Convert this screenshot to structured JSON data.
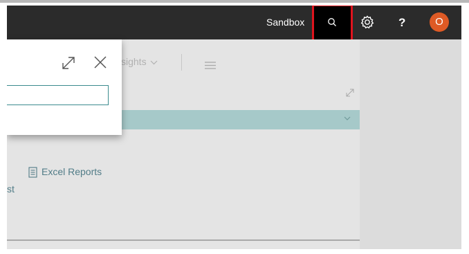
{
  "topbar": {
    "environment_label": "Sandbox",
    "search_icon": "search-icon",
    "settings_icon": "gear-icon",
    "help_label": "?",
    "avatar_initial": "O"
  },
  "nav": {
    "insights_label": "sights",
    "menu_icon": "hamburger-icon"
  },
  "content": {
    "expand_icon": "expand-icon",
    "chevron_icon": "chevron-down-icon",
    "excel_reports_label": "Excel Reports",
    "partial_link_label": "st"
  },
  "search_dialog": {
    "expand_icon": "expand-icon",
    "close_icon": "close-icon",
    "input_value": ""
  },
  "colors": {
    "topbar": "#2b2b2b",
    "highlight": "#e0141e",
    "avatar": "#de5a25",
    "accent_teal": "#a6c9c9",
    "link": "#517c87"
  }
}
